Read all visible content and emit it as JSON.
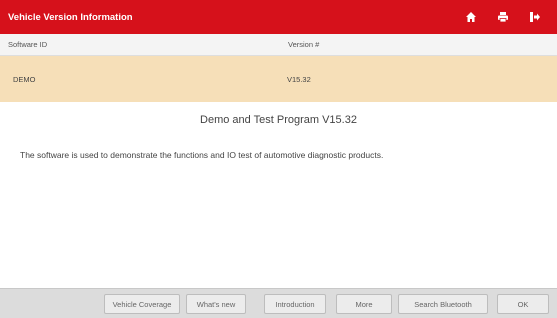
{
  "header": {
    "title": "Vehicle Version Information",
    "icons": [
      "home-icon",
      "print-icon",
      "exit-icon"
    ]
  },
  "table": {
    "columns": [
      "Software ID",
      "Version #"
    ],
    "rows": [
      {
        "software_id": "DEMO",
        "version": "V15.32"
      }
    ]
  },
  "content": {
    "program_title": "Demo and Test Program V15.32",
    "description": "The software is used to demonstrate the functions and IO test of automotive diagnostic products."
  },
  "footer": {
    "buttons": [
      "Vehicle Coverage",
      "What's new",
      "Introduction",
      "More",
      "Search Bluetooth",
      "OK"
    ]
  },
  "colors": {
    "header_bg": "#d6111b",
    "selected_row_bg": "#f6dfb8",
    "footer_bg": "#dcdcdc"
  }
}
